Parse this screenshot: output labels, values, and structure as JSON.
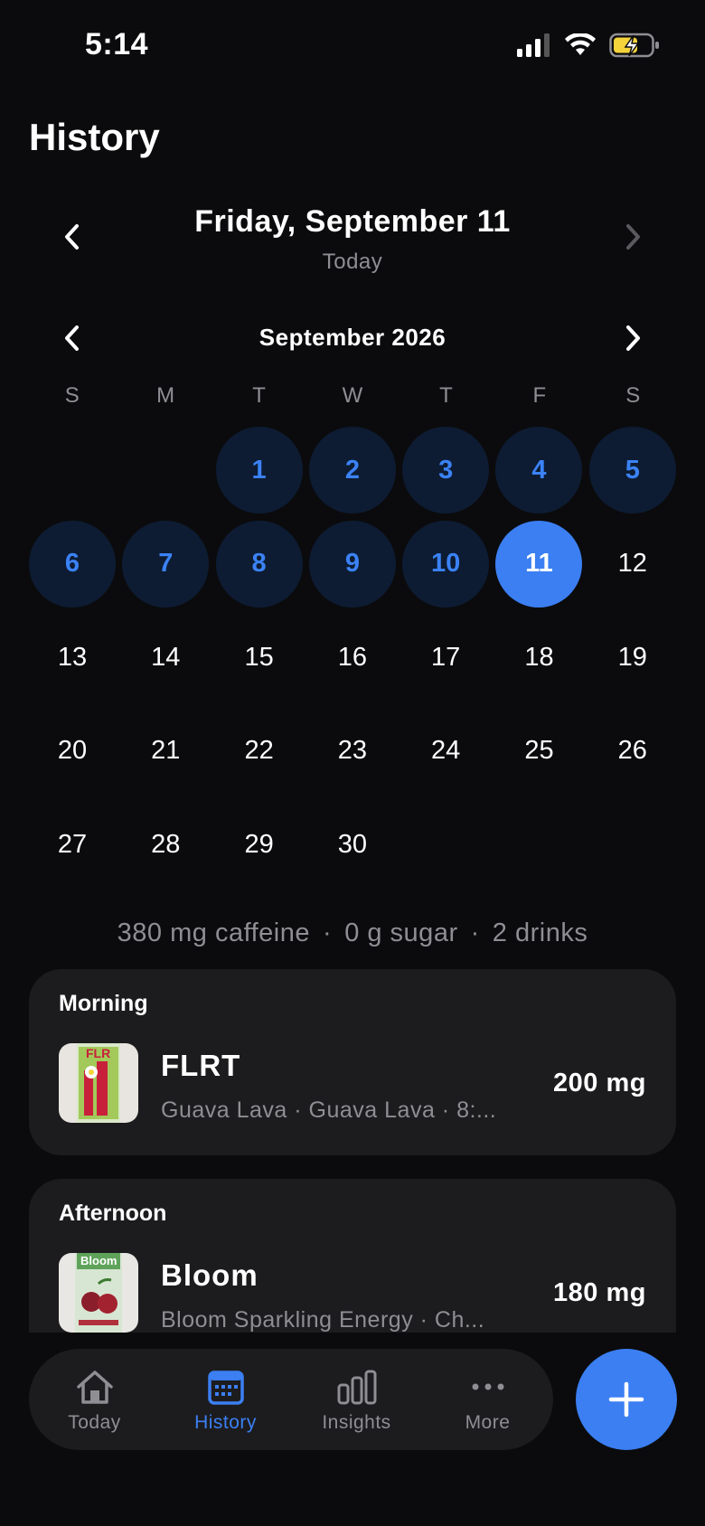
{
  "status_bar": {
    "time": "5:14"
  },
  "page": {
    "title": "History"
  },
  "day_nav": {
    "title": "Friday, September 11",
    "subtitle": "Today"
  },
  "calendar": {
    "month_title": "September 2026",
    "weekdays": [
      "S",
      "M",
      "T",
      "W",
      "T",
      "F",
      "S"
    ],
    "leading_blank_days": 2,
    "days": [
      {
        "n": "1",
        "state": "logged"
      },
      {
        "n": "2",
        "state": "logged"
      },
      {
        "n": "3",
        "state": "logged"
      },
      {
        "n": "4",
        "state": "logged"
      },
      {
        "n": "5",
        "state": "logged"
      },
      {
        "n": "6",
        "state": "logged"
      },
      {
        "n": "7",
        "state": "logged"
      },
      {
        "n": "8",
        "state": "logged"
      },
      {
        "n": "9",
        "state": "logged"
      },
      {
        "n": "10",
        "state": "logged"
      },
      {
        "n": "11",
        "state": "selected"
      },
      {
        "n": "12",
        "state": "none"
      },
      {
        "n": "13",
        "state": "none"
      },
      {
        "n": "14",
        "state": "none"
      },
      {
        "n": "15",
        "state": "none"
      },
      {
        "n": "16",
        "state": "none"
      },
      {
        "n": "17",
        "state": "none"
      },
      {
        "n": "18",
        "state": "none"
      },
      {
        "n": "19",
        "state": "none"
      },
      {
        "n": "20",
        "state": "none"
      },
      {
        "n": "21",
        "state": "none"
      },
      {
        "n": "22",
        "state": "none"
      },
      {
        "n": "23",
        "state": "none"
      },
      {
        "n": "24",
        "state": "none"
      },
      {
        "n": "25",
        "state": "none"
      },
      {
        "n": "26",
        "state": "none"
      },
      {
        "n": "27",
        "state": "none"
      },
      {
        "n": "28",
        "state": "none"
      },
      {
        "n": "29",
        "state": "none"
      },
      {
        "n": "30",
        "state": "none"
      }
    ]
  },
  "summary": {
    "caffeine": "380 mg caffeine",
    "sugar": "0 g sugar",
    "drinks": "2 drinks",
    "separator": "·"
  },
  "sections": [
    {
      "title": "Morning",
      "entries": [
        {
          "name": "FLRT",
          "detail": "Guava Lava · Guava Lava · 8:...",
          "amount": "200 mg",
          "thumb_icon": "flrt-can-thumbnail"
        }
      ]
    },
    {
      "title": "Afternoon",
      "entries": [
        {
          "name": "Bloom",
          "detail": "Bloom Sparkling Energy · Ch...",
          "amount": "180 mg",
          "thumb_icon": "bloom-can-thumbnail"
        }
      ]
    }
  ],
  "tabbar": {
    "tabs": [
      {
        "label": "Today",
        "icon": "home-icon",
        "active": false
      },
      {
        "label": "History",
        "icon": "calendar-icon",
        "active": true
      },
      {
        "label": "Insights",
        "icon": "bar-chart-icon",
        "active": false
      },
      {
        "label": "More",
        "icon": "ellipsis-icon",
        "active": false
      }
    ]
  },
  "colors": {
    "accent": "#3b7ff2",
    "logged_day_bg": "#0d1c33",
    "card_bg": "#1c1c1e",
    "background": "#0b0b0d",
    "muted_text": "#8e8e93"
  }
}
